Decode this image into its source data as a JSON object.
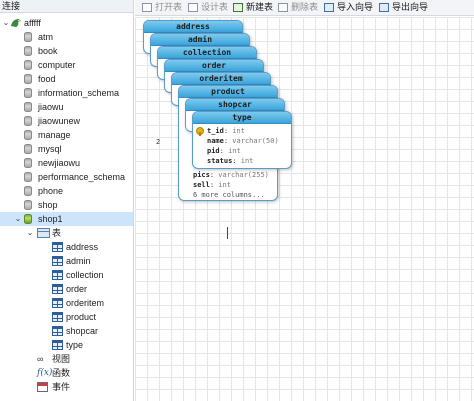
{
  "navigator": {
    "header": "连接",
    "connection": "afffff",
    "databases": [
      "atm",
      "book",
      "computer",
      "food",
      "information_schema",
      "jiaowu",
      "jiaowunew",
      "manage",
      "mysql",
      "newjiaowu",
      "performance_schema",
      "phone",
      "shop"
    ],
    "open_database": "shop1",
    "tables_folder": "表",
    "tables": [
      "address",
      "admin",
      "collection",
      "order",
      "orderitem",
      "product",
      "shopcar",
      "type"
    ],
    "views_folder": "视图",
    "functions_folder": "函数",
    "events_folder": "事件"
  },
  "toolbar": {
    "open_table": "打开表",
    "design_table": "设计表",
    "new_table": "新建表",
    "delete_table": "删除表",
    "import_wizard": "导入向导",
    "export_wizard": "导出向导"
  },
  "diagram": {
    "cards": [
      "address",
      "admin",
      "collection",
      "order",
      "orderitem",
      "product",
      "shopcar",
      "type"
    ],
    "type_columns": [
      {
        "name": "t_id",
        "type": "int"
      },
      {
        "name": "name",
        "type": "varchar(50)"
      },
      {
        "name": "pid",
        "type": "int"
      },
      {
        "name": "status",
        "type": "int"
      }
    ],
    "product_columns": [
      {
        "name": "pics",
        "type": "varchar(255)"
      },
      {
        "name": "sell",
        "type": "int"
      }
    ],
    "product_more": "6 more columns...",
    "peek_number": "2"
  },
  "colors": {
    "card_header": "#3aa5dc",
    "selection": "#cce5fb"
  }
}
